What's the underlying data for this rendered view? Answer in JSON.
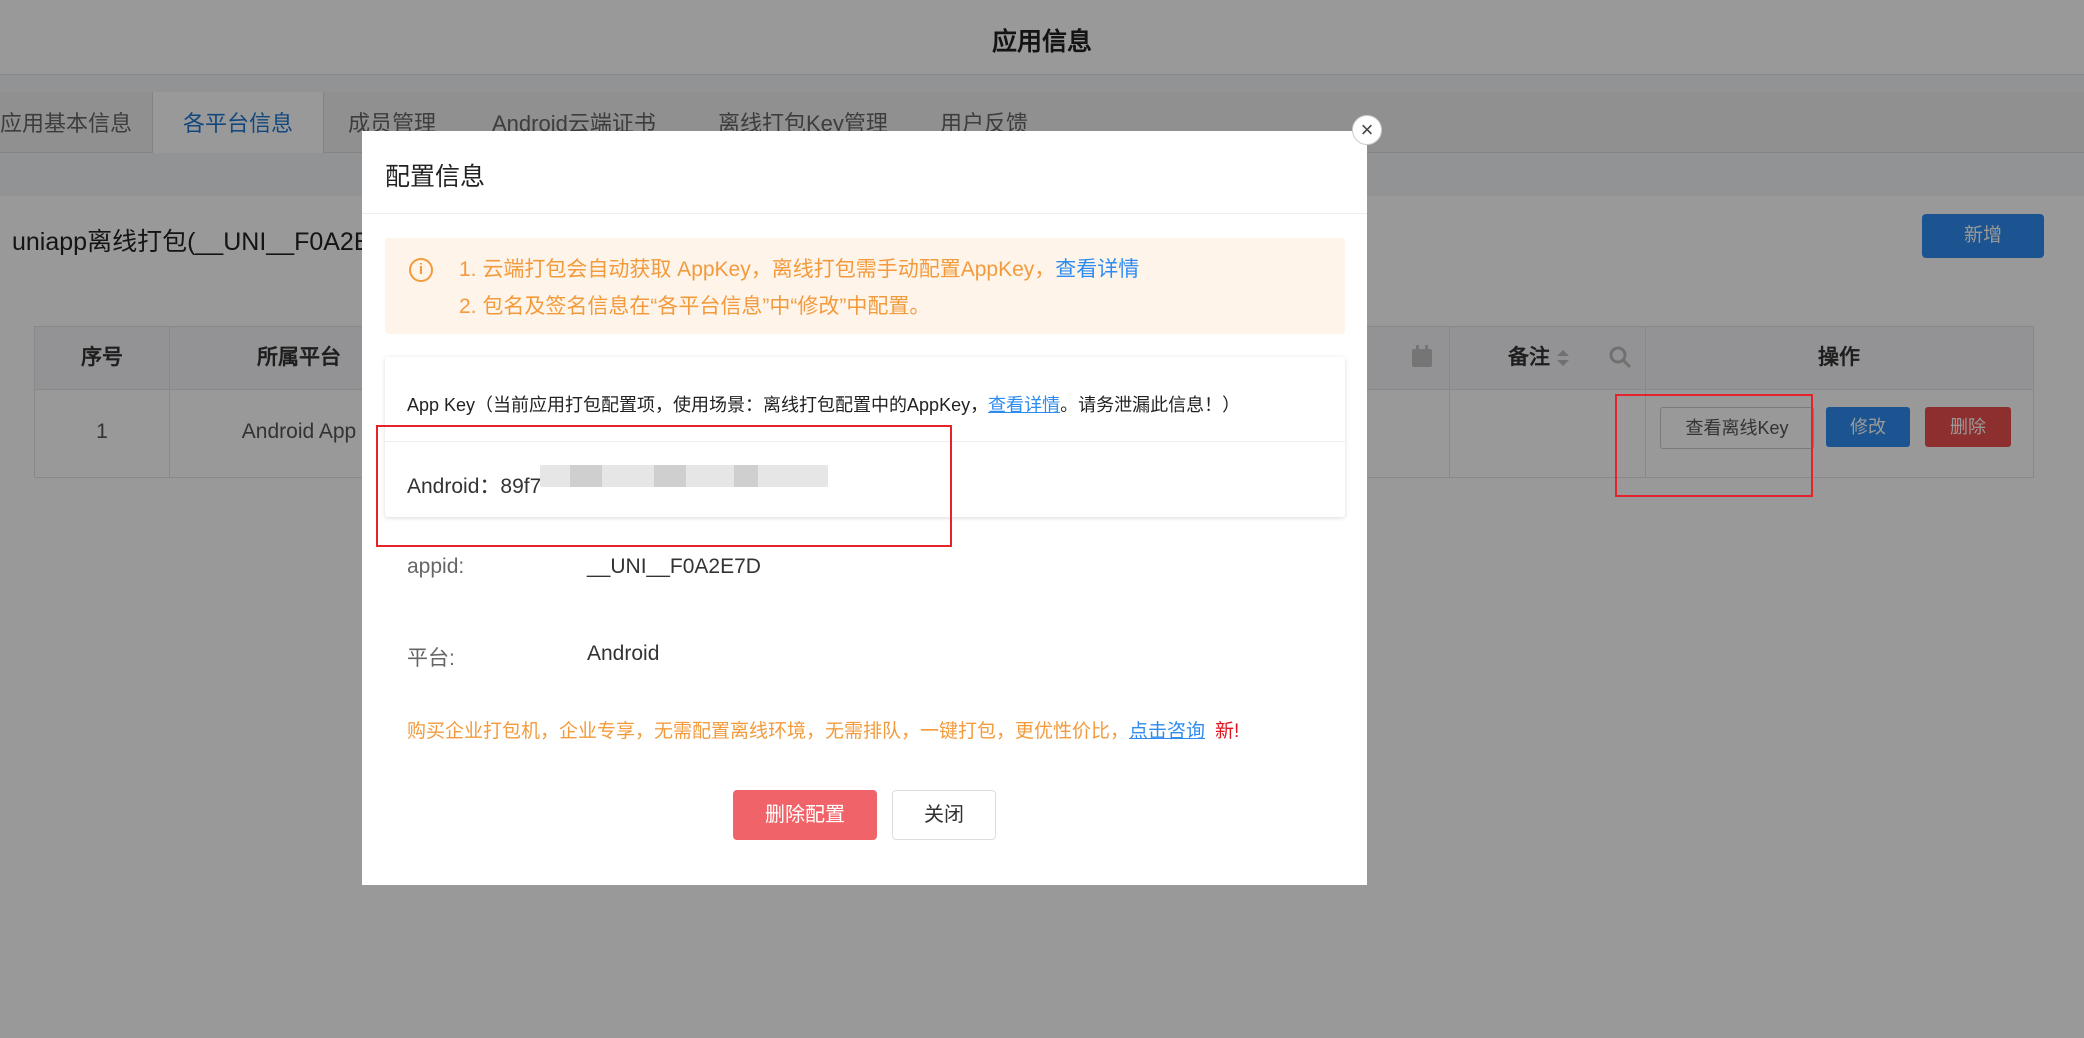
{
  "page": {
    "title": "应用信息",
    "tabs": [
      {
        "label": "应用基本信息"
      },
      {
        "label": "各平台信息"
      },
      {
        "label": "成员管理"
      },
      {
        "label": "Android云端证书"
      },
      {
        "label": "离线打包Key管理"
      },
      {
        "label": "用户反馈"
      }
    ],
    "section_title": "uniapp离线打包(__UNI__F0A2E",
    "add_button": "新增",
    "table": {
      "headers": [
        "序号",
        "所属平台",
        "备注",
        "操作"
      ],
      "row": {
        "index": "1",
        "platform": "Android App"
      },
      "actions": {
        "view_key": "查看离线Key",
        "edit": "修改",
        "delete": "删除"
      }
    }
  },
  "modal": {
    "title": "配置信息",
    "close_symbol": "×",
    "info_symbol": "i",
    "notice": {
      "line1_prefix": "1. 云端打包会自动获取 AppKey，离线打包需手动配置AppKey，",
      "line1_link": "查看详情",
      "line2": "2. 包名及签名信息在“各平台信息”中“修改”中配置。"
    },
    "appkey": {
      "head_prefix": "App Key（当前应用打包配置项，使用场景：离线打包配置中的AppKey，",
      "head_link": "查看详情",
      "head_suffix": "。请务泄漏此信息！）",
      "android_label": "Android：",
      "android_value": "89f7"
    },
    "fields": {
      "appid_label": "appid:",
      "appid_value": "__UNI__F0A2E7D",
      "platform_label": "平台:",
      "platform_value": "Android"
    },
    "promo": {
      "text": "购买企业打包机，企业专享，无需配置离线环境，无需排队，一键打包，更优性价比，",
      "link": "点击咨询",
      "badge": "新!"
    },
    "buttons": {
      "delete_config": "删除配置",
      "close": "关闭"
    }
  },
  "colors": {
    "accent": "#2d8cf0",
    "warning": "#f39b3c",
    "danger": "#f06469",
    "highlight": "#e5232a"
  }
}
